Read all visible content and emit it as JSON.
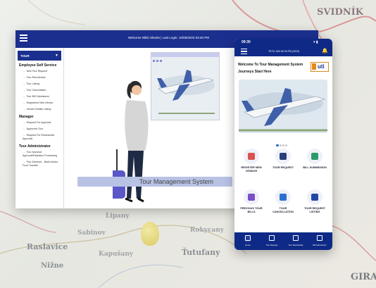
{
  "map": {
    "labels": [
      "SVIDNÍK",
      "Raslavice",
      "Nižne",
      "Lipany",
      "Rokycany",
      "Sabinov",
      "Kapušany",
      "Ťutufany",
      "GIRA"
    ]
  },
  "desktop": {
    "header_text": "Welcome Nikki Sheela | Last Login: 10/06/2023 03:40 PM",
    "sidebar_title": "TOUR",
    "sidebar_groups": [
      {
        "title": "Employee Self Service",
        "items": [
          "New Tour Request",
          "Tour Reschedule",
          "Tour Listing",
          "Tour Cancellation",
          "Tour Bill Submission",
          "Registered New Vendor",
          "Vendor Details Listing"
        ]
      },
      {
        "title": "Manager",
        "items": [
          "Request For Approval",
          "Approved Tour",
          "Request For Reschedule Approval"
        ]
      },
      {
        "title": "Tour Administrator",
        "items": [
          "Tour Advance Approval/Rejection Processing",
          "Tour Advance - Bank Advice Fund Transfer"
        ]
      }
    ],
    "banner_text": "Tour Management System"
  },
  "mobile": {
    "time": "09:30",
    "header_text": "TETH JUN 05 09 PM (2023)",
    "welcome_line1": "Welcome To Tour Management System",
    "welcome_line2": "Journeys Start Here",
    "logo_text": "uti",
    "tiles": [
      {
        "label": "REGISTER NEW VENDOR",
        "icon": "vendor-icon"
      },
      {
        "label": "TOUR REQUEST",
        "icon": "tour-request-icon"
      },
      {
        "label": "BILL SUBMISSION",
        "icon": "bill-icon"
      },
      {
        "label": "PREVIOUS TOUR BILLS",
        "icon": "previous-bills-icon"
      },
      {
        "label": "TOUR CANCELLATION",
        "icon": "cancel-icon"
      },
      {
        "label": "TOUR REQUEST LISTING",
        "icon": "listing-icon"
      }
    ],
    "tabs": [
      {
        "label": "Home",
        "icon": "home-icon"
      },
      {
        "label": "Tour Request",
        "icon": "tour-icon"
      },
      {
        "label": "Tour Reschedule",
        "icon": "reschedule-icon"
      },
      {
        "label": "Bill Submission",
        "icon": "bill-tab-icon"
      }
    ]
  },
  "colors": {
    "brand": "#1b2f8e",
    "accent": "#2c5fd1"
  }
}
